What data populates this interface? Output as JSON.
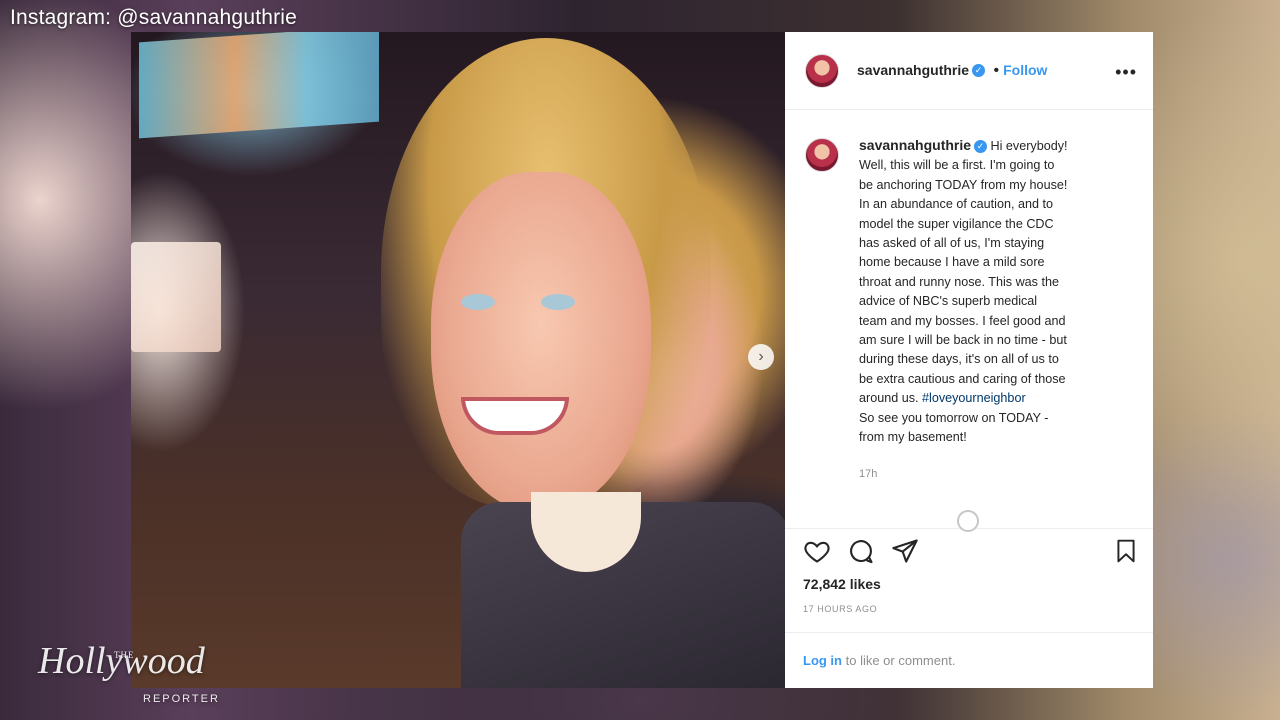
{
  "watermark": {
    "source": "Instagram: @savannahguthrie"
  },
  "logo": {
    "the": "THE",
    "name": "Hollywood",
    "reporter": "REPORTER"
  },
  "post": {
    "username": "savannahguthrie",
    "follow_label": "Follow",
    "separator": "•",
    "more": "•••",
    "caption_lines": [
      "Hi everybody!",
      "Well, this will be a first. I'm going to",
      "be anchoring TODAY from my house!",
      "In an abundance of caution, and to",
      "model the super vigilance the CDC",
      "has asked of all of us, I'm staying",
      "home because I have a mild sore",
      "throat and runny nose. This was the",
      "advice of NBC's superb medical",
      "team and my bosses. I feel good and",
      "am sure I will be back in no time - but",
      "during these days, it's on all of us to",
      "be extra cautious and caring of those",
      "around us.",
      "#loveyourneighbor",
      "So see you tomorrow on TODAY -",
      "from my basement!"
    ],
    "comment_age": "17h",
    "likes": "72,842 likes",
    "posted": "17 HOURS AGO",
    "login_link": "Log in",
    "login_rest": " to like or comment."
  },
  "icons": {
    "verified": "verified-badge-icon",
    "heart": "heart-icon",
    "comment": "comment-icon",
    "share": "paper-plane-icon",
    "bookmark": "bookmark-icon",
    "more": "more-dots-icon",
    "next": "chevron-right-icon"
  },
  "colors": {
    "link": "#3897f0",
    "text": "#262626",
    "muted": "#8e8e8e",
    "hashtag": "#00376b"
  }
}
